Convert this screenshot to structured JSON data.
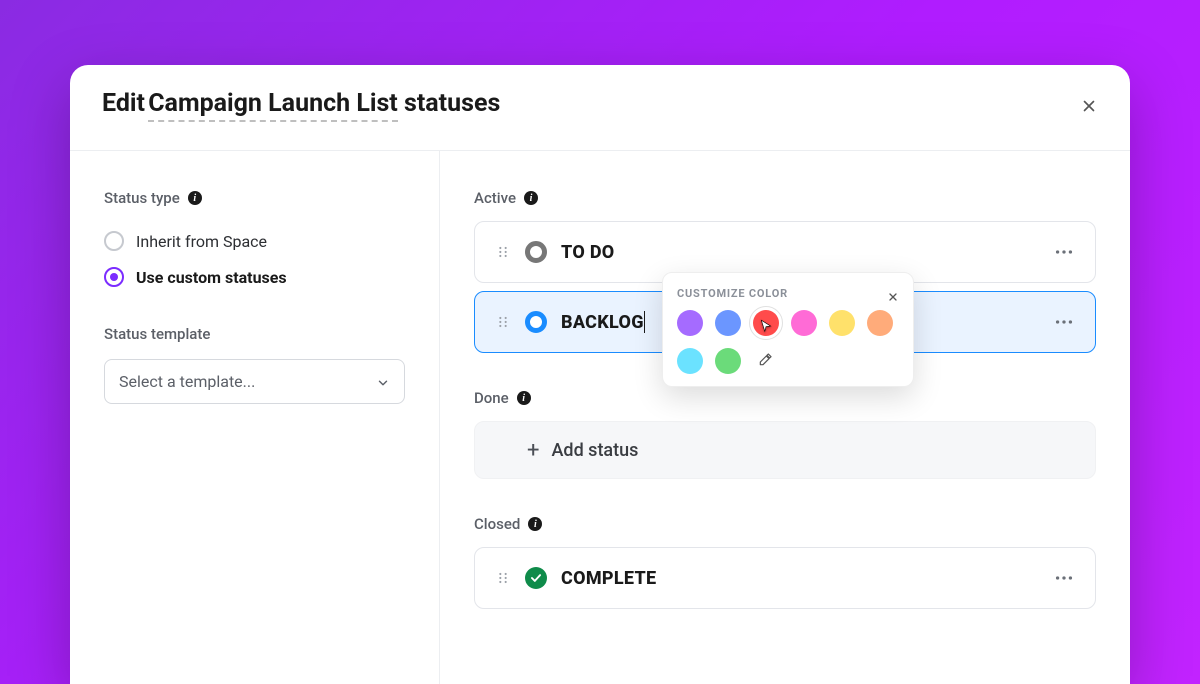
{
  "modal": {
    "title_prefix": "Edit ",
    "title_underlined": "Campaign Launch List",
    "title_suffix": " statuses"
  },
  "sidebar": {
    "status_type_label": "Status type",
    "radios": [
      {
        "label": "Inherit from Space",
        "selected": false
      },
      {
        "label": "Use custom statuses",
        "selected": true
      }
    ],
    "template_label": "Status template",
    "template_placeholder": "Select a template..."
  },
  "groups": {
    "active_label": "Active",
    "done_label": "Done",
    "closed_label": "Closed",
    "add_status_label": "Add status"
  },
  "statuses": {
    "todo": "TO DO",
    "backlog": "BACKLOG",
    "complete": "COMPLETE"
  },
  "popover": {
    "title": "CUSTOMIZE COLOR",
    "colors": [
      {
        "name": "purple",
        "hex": "#a56bff",
        "selected": false
      },
      {
        "name": "blue",
        "hex": "#6b96ff",
        "selected": false
      },
      {
        "name": "red",
        "hex": "#ff4b4b",
        "selected": true
      },
      {
        "name": "pink",
        "hex": "#ff6bd6",
        "selected": false
      },
      {
        "name": "yellow",
        "hex": "#ffe16b",
        "selected": false
      },
      {
        "name": "coral",
        "hex": "#ffab7a",
        "selected": false
      },
      {
        "name": "cyan",
        "hex": "#6be2ff",
        "selected": false
      },
      {
        "name": "green",
        "hex": "#6bdb7a",
        "selected": false
      }
    ]
  }
}
